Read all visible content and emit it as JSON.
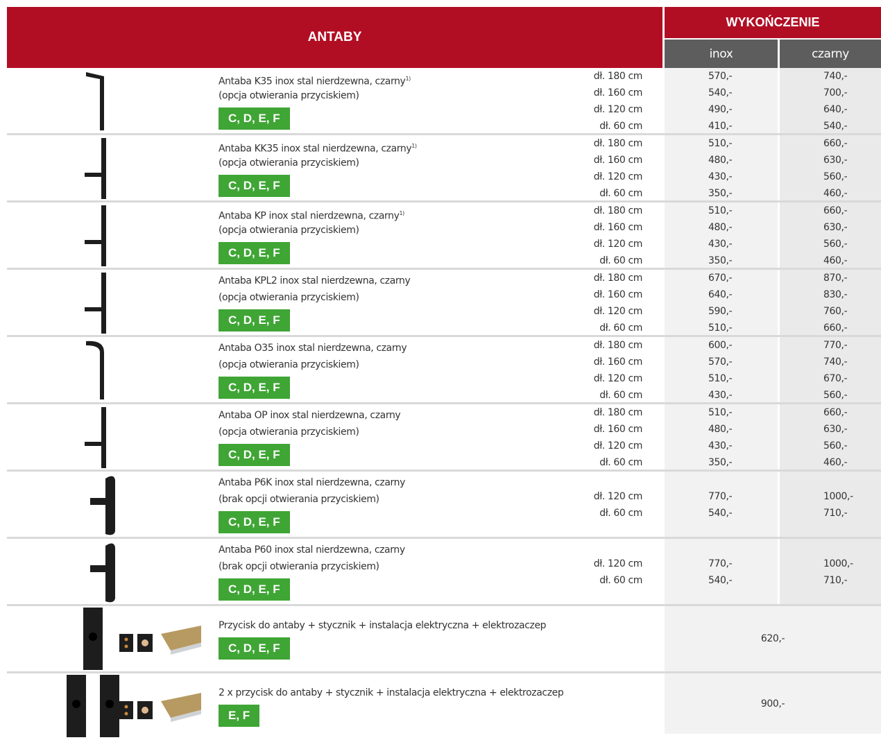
{
  "header": {
    "title": "ANTABY",
    "finish": "WYKOŃCZENIE",
    "col_inox": "inox",
    "col_czarny": "czarny"
  },
  "colors": {
    "brand_red": "#b10e24",
    "badge_green": "#3fa535",
    "subheader_gray": "#5d5d5d"
  },
  "rows": [
    {
      "name": "Antaba K35 inox stal nierdzewna, czarny",
      "note": "1)",
      "option": "(opcja otwierania przyciskiem)",
      "badge": "C, D, E, F",
      "lengths": [
        "dł. 180 cm",
        "dł. 160 cm",
        "dł. 120 cm",
        "dł. 60 cm"
      ],
      "inox": [
        "570,-",
        "540,-",
        "490,-",
        "410,-"
      ],
      "czarny": [
        "740,-",
        "700,-",
        "640,-",
        "540,-"
      ]
    },
    {
      "name": "Antaba KK35 inox stal nierdzewna, czarny",
      "note": "1)",
      "option": "(opcja otwierania przyciskiem)",
      "badge": "C, D, E, F",
      "lengths": [
        "dł. 180 cm",
        "dł. 160 cm",
        "dł. 120 cm",
        "dł. 60 cm"
      ],
      "inox": [
        "510,-",
        "480,-",
        "430,-",
        "350,-"
      ],
      "czarny": [
        "660,-",
        "630,-",
        "560,-",
        "460,-"
      ]
    },
    {
      "name": "Antaba KP inox stal nierdzewna, czarny",
      "note": "1)",
      "option": "(opcja otwierania przyciskiem)",
      "badge": "C, D, E, F",
      "lengths": [
        "dł. 180 cm",
        "dł. 160 cm",
        "dł. 120 cm",
        "dł. 60 cm"
      ],
      "inox": [
        "510,-",
        "480,-",
        "430,-",
        "350,-"
      ],
      "czarny": [
        "660,-",
        "630,-",
        "560,-",
        "460,-"
      ]
    },
    {
      "name": "Antaba KPL2 inox stal nierdzewna, czarny",
      "note": "",
      "option": "(opcja otwierania przyciskiem)",
      "badge": "C, D, E, F",
      "lengths": [
        "dł. 180 cm",
        "dł. 160 cm",
        "dł. 120 cm",
        "dł. 60 cm"
      ],
      "inox": [
        "670,-",
        "640,-",
        "590,-",
        "510,-"
      ],
      "czarny": [
        "870,-",
        "830,-",
        "760,-",
        "660,-"
      ]
    },
    {
      "name": "Antaba O35 inox stal nierdzewna, czarny",
      "note": "",
      "option": "(opcja otwierania przyciskiem)",
      "badge": "C, D, E, F",
      "lengths": [
        "dł. 180 cm",
        "dł. 160 cm",
        "dł. 120 cm",
        "dł. 60 cm"
      ],
      "inox": [
        "600,-",
        "570,-",
        "510,-",
        "430,-"
      ],
      "czarny": [
        "770,-",
        "740,-",
        "670,-",
        "560,-"
      ]
    },
    {
      "name": "Antaba OP inox stal nierdzewna, czarny",
      "note": "",
      "option": "(opcja otwierania przyciskiem)",
      "badge": "C, D, E, F",
      "lengths": [
        "dł. 180 cm",
        "dł. 160 cm",
        "dł. 120 cm",
        "dł. 60 cm"
      ],
      "inox": [
        "510,-",
        "480,-",
        "430,-",
        "350,-"
      ],
      "czarny": [
        "660,-",
        "630,-",
        "560,-",
        "460,-"
      ]
    },
    {
      "name": "Antaba P6K inox stal nierdzewna, czarny",
      "note": "",
      "option": "(brak opcji otwierania przyciskiem)",
      "badge": "C, D, E, F",
      "lengths": [
        "dł. 120 cm",
        "dł. 60 cm"
      ],
      "inox": [
        "770,-",
        "540,-"
      ],
      "czarny": [
        "1000,-",
        "710,-"
      ]
    },
    {
      "name": "Antaba P60 inox stal nierdzewna, czarny",
      "note": "",
      "option": "(brak opcji otwierania przyciskiem)",
      "badge": "C, D, E, F",
      "lengths": [
        "dł. 120 cm",
        "dł. 60 cm"
      ],
      "inox": [
        "770,-",
        "540,-"
      ],
      "czarny": [
        "1000,-",
        "710,-"
      ]
    }
  ],
  "extras": [
    {
      "name": "Przycisk do antaby + stycznik + instalacja elektryczna + elektrozaczep",
      "badge": "C, D, E, F",
      "price": "620,-"
    },
    {
      "name": "2 x przycisk do antaby + stycznik + instalacja elektryczna + elektrozaczep",
      "badge": "E, F",
      "price": "900,-"
    }
  ]
}
